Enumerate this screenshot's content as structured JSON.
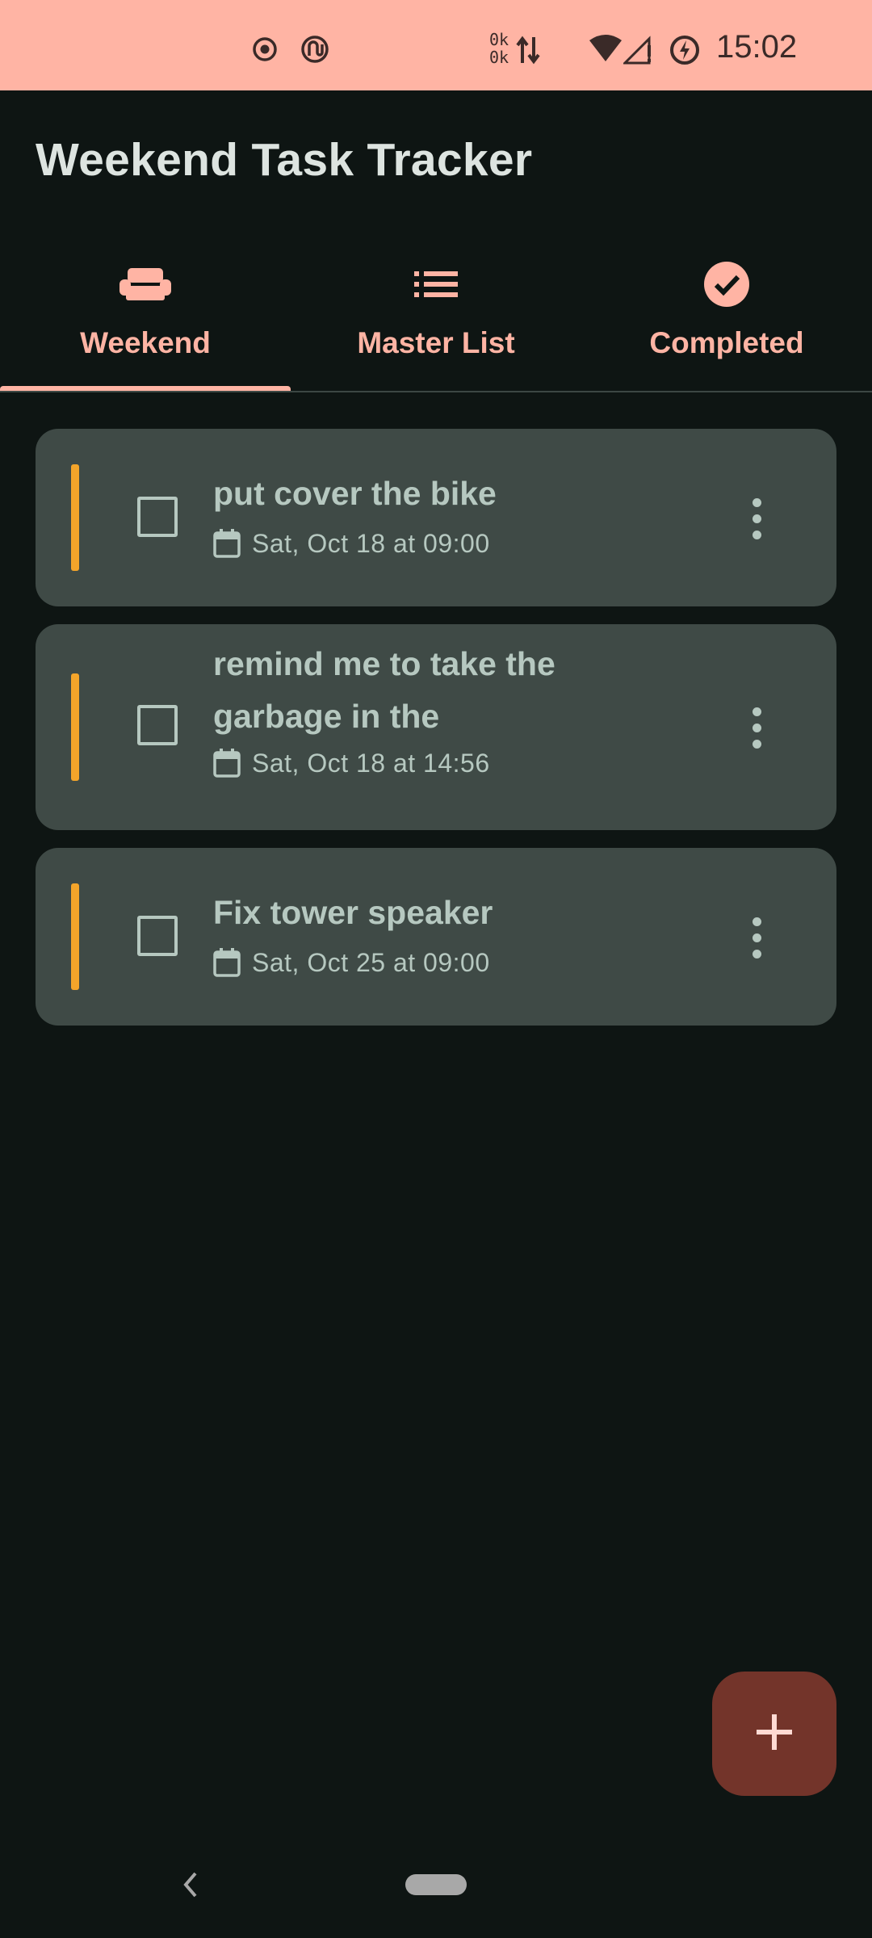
{
  "status_bar": {
    "time": "15:02",
    "net_up": "0k",
    "net_down": "0k",
    "background": "#ffb4a4",
    "icons": [
      "record-icon",
      "app-notification-icon",
      "data-transfer-icon",
      "wifi-icon",
      "cell-signal-icon",
      "battery-saver-icon"
    ]
  },
  "app": {
    "title": "Weekend Task Tracker",
    "accent_color": "#ffb4a4"
  },
  "tabs": [
    {
      "label": "Weekend",
      "icon": "couch-icon",
      "selected": true
    },
    {
      "label": "Master List",
      "icon": "list-icon",
      "selected": false
    },
    {
      "label": "Completed",
      "icon": "check-circle-icon",
      "selected": false
    }
  ],
  "tasks": [
    {
      "title": "put cover the bike",
      "date": "Sat, Oct 18 at 09:00",
      "checked": false,
      "priority_color": "#f4a52a"
    },
    {
      "title_line1": "remind me to take the",
      "title_line2": "garbage in the",
      "date": "Sat, Oct 18 at 14:56",
      "checked": false,
      "priority_color": "#f4a52a"
    },
    {
      "title": "Fix tower speaker",
      "date": "Sat, Oct 25 at 09:00",
      "checked": false,
      "priority_color": "#f4a52a"
    }
  ],
  "fab": {
    "icon": "plus-icon",
    "color": "#73342a"
  },
  "nav": {
    "back_icon": "back-chevron-icon",
    "home_icon": "home-pill-icon"
  }
}
